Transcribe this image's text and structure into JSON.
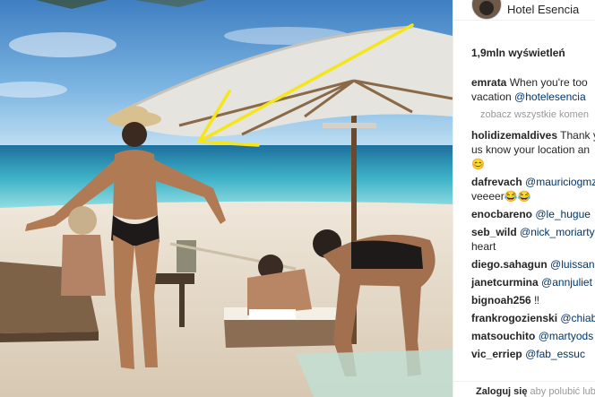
{
  "post": {
    "account_name": "Hotel Esencia",
    "views": "1,9mln wyświetleń",
    "caption": {
      "user": "emrata",
      "text": "When you're too",
      "text2": "vacation",
      "mention": "@hotelesencia"
    },
    "load_more": "zobacz wszystkie komen"
  },
  "comments": [
    {
      "user": "holidizemaldives",
      "text": "Thank y",
      "text2": "us know your location an",
      "text3": "😊"
    },
    {
      "user": "dafrevach",
      "mention": "@mauriciogmz",
      "text2": "veeeer😂😂"
    },
    {
      "user": "enocbareno",
      "mention": "@le_hugue"
    },
    {
      "user": "seb_wild",
      "mention": "@nick_moriarty",
      "text2": "heart"
    },
    {
      "user": "diego.sahagun",
      "mention": "@luissand"
    },
    {
      "user": "janetcurmina",
      "mention": "@annjuliet"
    },
    {
      "user": "bignoah256",
      "text": "‼"
    },
    {
      "user": "frankrogozienski",
      "mention": "@chiab"
    },
    {
      "user": "matsouchito",
      "mention": "@martyods"
    },
    {
      "user": "vic_erriep",
      "mention": "@fab_essuc"
    }
  ],
  "footer": {
    "login": "Zaloguj się",
    "text": "aby polubić lub"
  },
  "colors": {
    "link": "#003569",
    "annotation_arrow": "#f5e61a",
    "panel_border": "#efefef"
  },
  "icons": {
    "annotation": "yellow-arrow"
  }
}
